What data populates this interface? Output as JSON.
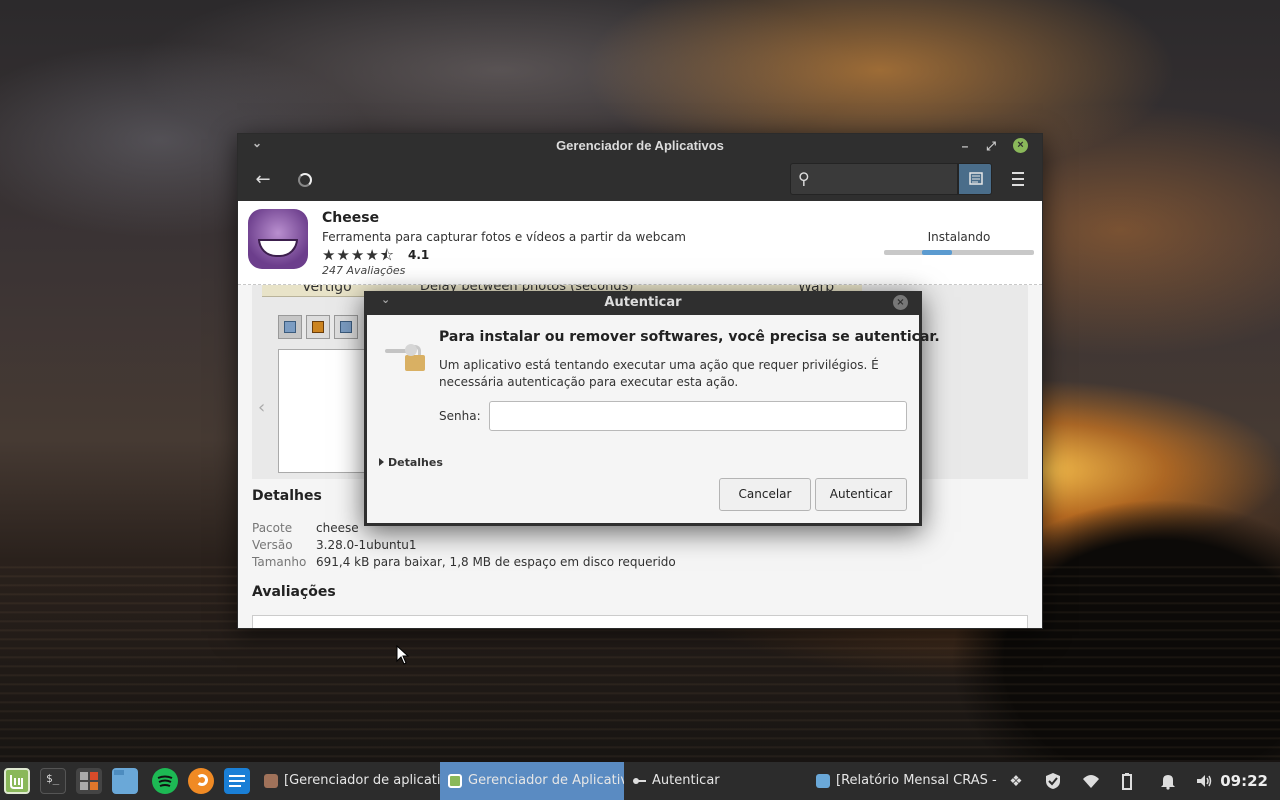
{
  "main_window": {
    "title": "Gerenciador de Aplicativos",
    "search": {
      "value": "",
      "placeholder": ""
    }
  },
  "app": {
    "name": "Cheese",
    "description": "Ferramenta para capturar fotos e vídeos a partir da webcam",
    "stars": "★★★★⯪",
    "rating": "4.1",
    "reviews": "247 Avaliações",
    "status": "Instalando",
    "progress": 0.2
  },
  "screenshot": {
    "strip_text_left": "Vertigo",
    "strip_text_mid": "Delay between photos (seconds)",
    "strip_text_right": "Warp"
  },
  "details": {
    "title": "Detalhes",
    "rows": [
      {
        "key": "Pacote",
        "value": "cheese"
      },
      {
        "key": "Versão",
        "value": "3.28.0-1ubuntu1"
      },
      {
        "key": "Tamanho",
        "value": "691,4 kB para baixar, 1,8 MB de espaço em disco requerido"
      }
    ]
  },
  "reviews_section": {
    "title": "Avaliações"
  },
  "auth_dialog": {
    "title": "Autenticar",
    "heading": "Para instalar ou remover softwares, você precisa se autenticar.",
    "message": "Um aplicativo está tentando executar uma ação que requer privilégios. É necessária autenticação para executar esta ação.",
    "password_label": "Senha:",
    "password_value": "",
    "details_toggle": "Detalhes",
    "cancel_label": "Cancelar",
    "auth_label": "Autenticar"
  },
  "taskbar": {
    "tasks": [
      {
        "label": "[Gerenciador de aplicativ...",
        "active": false
      },
      {
        "label": "Gerenciador de Aplicativos",
        "active": true
      },
      {
        "label": "Autenticar",
        "active": false
      },
      {
        "label": "[Relatório Mensal CRAS - ...",
        "active": false
      }
    ],
    "clock": "09:22"
  },
  "colors": {
    "accent": "#5a8bc2",
    "mint_green": "#8ab85a",
    "titlebar": "#2f2f2f"
  }
}
